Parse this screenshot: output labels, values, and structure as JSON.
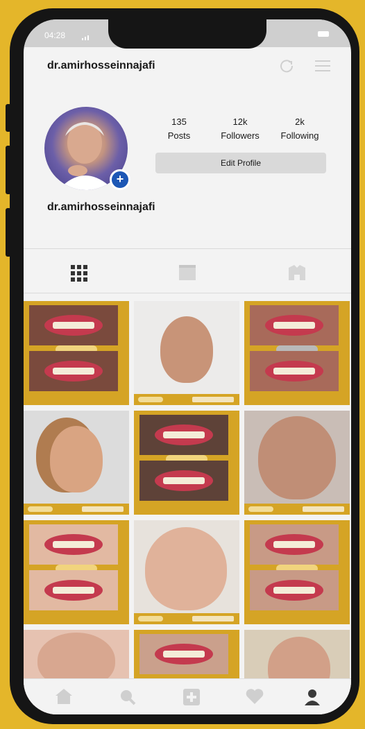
{
  "status_bar": {
    "time": "04:28"
  },
  "header": {
    "username": "dr.amirhosseinnajafi"
  },
  "profile": {
    "name": "dr.amirhosseinnajafi"
  },
  "stats": {
    "posts": {
      "value": "135",
      "label": "Posts"
    },
    "followers": {
      "value": "12k",
      "label": "Followers"
    },
    "following": {
      "value": "2k",
      "label": "Following"
    }
  },
  "edit_profile": {
    "label": "Edit Profile"
  },
  "tabs": [
    {
      "icon": "grid-icon",
      "active": true
    },
    {
      "icon": "feed-icon",
      "active": false
    },
    {
      "icon": "tagged-icon",
      "active": false
    }
  ],
  "posts_grid": [
    {
      "type": "teeth"
    },
    {
      "type": "portrait"
    },
    {
      "type": "teeth"
    },
    {
      "type": "portrait"
    },
    {
      "type": "teeth"
    },
    {
      "type": "portrait"
    },
    {
      "type": "teeth"
    },
    {
      "type": "portrait"
    },
    {
      "type": "teeth"
    },
    {
      "type": "portrait"
    },
    {
      "type": "teeth"
    },
    {
      "type": "portrait"
    }
  ],
  "bottom_nav": [
    "home-icon",
    "search-icon",
    "add-post-icon",
    "activity-heart-icon",
    "profile-icon"
  ],
  "colors": {
    "frame": "#e4b62a",
    "post_accent": "#d5a425",
    "badge": "#1c57b5"
  }
}
